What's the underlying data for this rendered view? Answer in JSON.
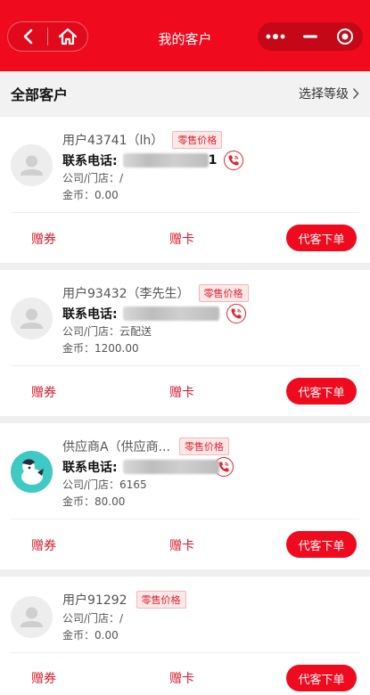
{
  "header": {
    "title": "我的客户",
    "back_icon": "chevron-left-icon",
    "home_icon": "home-icon",
    "menu_icon": "more-dots-icon",
    "minimize_icon": "minus-icon",
    "close_icon": "target-icon",
    "color": "#f00a1e"
  },
  "filter": {
    "all_label": "全部客户",
    "level_label": "选择等级"
  },
  "customers": [
    {
      "name": "用户43741（lh）",
      "badge": "零售价格",
      "phone_label": "联系电话:",
      "phone_tail": "1",
      "store": "公司/门店：/",
      "coins": "金币：0.00",
      "coupon_label": "赠券",
      "card_label": "赠卡",
      "order_label": "代客下单"
    },
    {
      "name": "用户93432（李先生）",
      "badge": "零售价格",
      "phone_label": "联系电话:",
      "phone_tail": "",
      "store": "公司/门店：云配送",
      "coins": "金币：1200.00",
      "coupon_label": "赠券",
      "card_label": "赠卡",
      "order_label": "代客下单"
    },
    {
      "name": "供应商A（供应商...",
      "badge": "零售价格",
      "phone_label": "联系电话:",
      "phone_tail": "",
      "store": "公司/门店：6165",
      "coins": "金币：80.00",
      "coupon_label": "赠券",
      "card_label": "赠卡",
      "order_label": "代客下单"
    },
    {
      "name": "用户91292",
      "badge": "零售价格",
      "store": "公司/门店：/",
      "coins": "金币：0.00",
      "coupon_label": "赠券",
      "card_label": "赠卡",
      "order_label": "代客下单"
    }
  ]
}
